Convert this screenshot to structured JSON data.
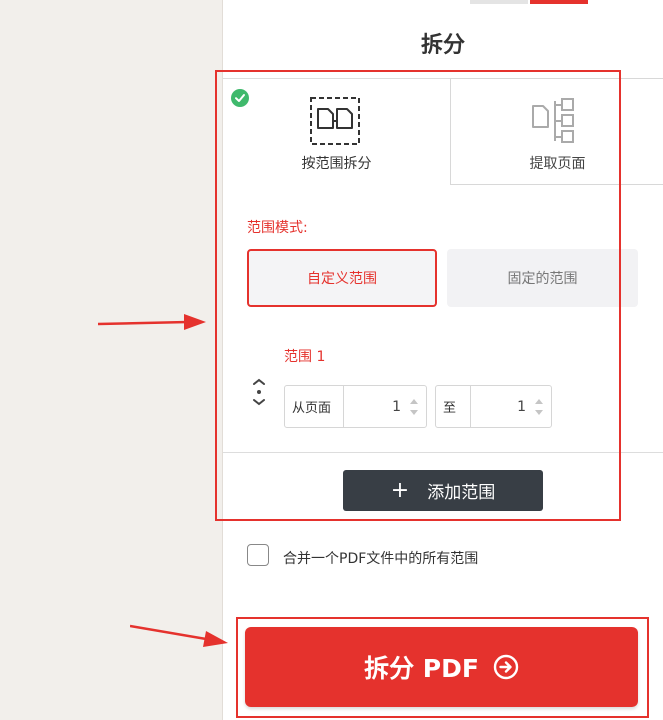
{
  "header": {
    "title": "拆分"
  },
  "mode_tabs": [
    {
      "label": "按范围拆分",
      "icon": "split-range-icon",
      "selected": true
    },
    {
      "label": "提取页面",
      "icon": "extract-pages-icon",
      "selected": false
    }
  ],
  "range_mode": {
    "label": "范围模式:",
    "options": [
      {
        "label": "自定义范围",
        "selected": true
      },
      {
        "label": "固定的范围",
        "selected": false
      }
    ]
  },
  "range": {
    "title": "范围 1",
    "from_label": "从页面",
    "from_value": "1",
    "to_label": "至",
    "to_value": "1"
  },
  "add_range": {
    "plus": "+",
    "label": "添加范围"
  },
  "merge": {
    "label": "合并一个PDF文件中的所有范围",
    "checked": false
  },
  "submit": {
    "label": "拆分 PDF"
  },
  "colors": {
    "accent": "#e5322d",
    "dark_button": "#383e45",
    "check": "#3fb96c"
  }
}
